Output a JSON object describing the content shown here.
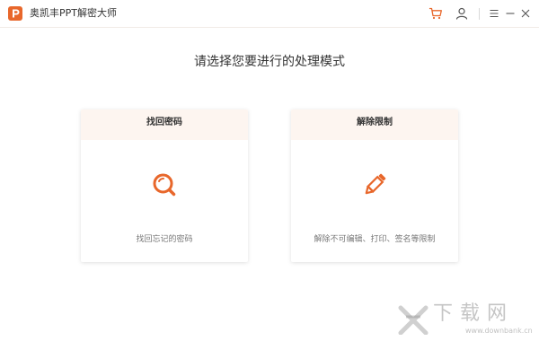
{
  "titlebar": {
    "app_title": "奥凯丰PPT解密大师",
    "icons": [
      "app-logo",
      "cart-icon",
      "user-icon",
      "menu-icon",
      "minimize-icon",
      "close-icon"
    ]
  },
  "main": {
    "heading": "请选择您要进行的处理模式"
  },
  "cards": [
    {
      "title": "找回密码",
      "description": "找回忘记的密码",
      "icon": "magnifier-icon"
    },
    {
      "title": "解除限制",
      "description": "解除不可编辑、打印、签名等限制",
      "icon": "pencil-icon"
    }
  ],
  "watermark": {
    "text": "下载网",
    "url": "www.downbank.cn"
  },
  "colors": {
    "accent": "#e8672b",
    "card_header": "#fdf5f0",
    "title_text": "#333333",
    "desc_text": "#777777"
  }
}
